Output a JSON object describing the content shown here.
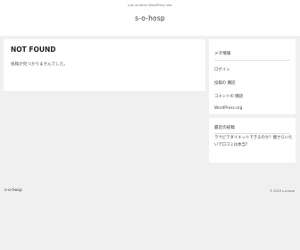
{
  "header": {
    "tagline": "Just another WordPress site",
    "site_title": "s-o-hosp"
  },
  "main": {
    "heading": "NOT FOUND",
    "message": "投稿が見つかりませんでした。"
  },
  "sidebar": {
    "meta_title": "メタ情報",
    "meta_links": [
      "ログイン",
      "投稿の 購読",
      "コメントの 購読",
      "WordPress.org"
    ],
    "recent_title": "最近の投稿",
    "recent_post": "ラクビでダイエットできるのか？痩せらいたいで口コミは本当？"
  },
  "footer": {
    "site_title": "s-o-hosp",
    "copyright": "© 2019 s-o-hosp"
  }
}
